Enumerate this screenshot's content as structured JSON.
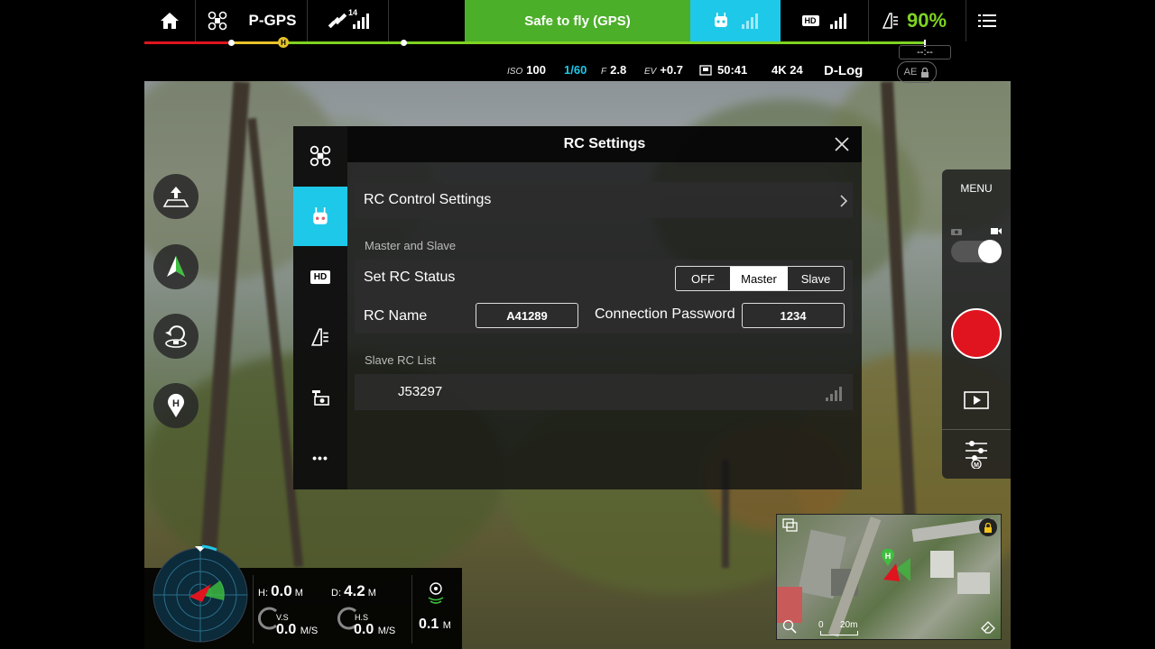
{
  "topbar": {
    "flight_mode": "P-GPS",
    "satellite_count": "14",
    "status_text": "Safe to fly (GPS)",
    "status_color": "#4caf2a",
    "rc_signal_color": "#1ec8e8",
    "hd_label": "HD",
    "battery_percent": "90%",
    "battery_color": "#7ed321",
    "flight_time": "--:--"
  },
  "camera": {
    "iso_label": "ISO",
    "iso_value": "100",
    "shutter": "1/60",
    "aperture_label": "F",
    "aperture_value": "2.8",
    "ev_label": "EV",
    "ev_value": "+0.7",
    "remaining_time": "50:41",
    "resolution": "4K 24",
    "color_profile": "D-Log",
    "ae_label": "AE"
  },
  "dialog": {
    "title": "RC Settings",
    "rc_control_settings": "RC Control Settings",
    "section_master_slave": "Master and Slave",
    "set_rc_status_label": "Set RC Status",
    "status_options": [
      "OFF",
      "Master",
      "Slave"
    ],
    "status_selected": "Master",
    "rc_name_label": "RC Name",
    "rc_name_value": "A41289",
    "connection_password_label": "Connection Password",
    "connection_password_value": "1234",
    "section_slave_list": "Slave RC List",
    "slave_rc": "J53297",
    "sidebar_hd": "HD",
    "sidebar_more": "•••",
    "active_tab_color": "#1ec8e8"
  },
  "campanel": {
    "menu_label": "MENU",
    "record_color": "#e0141e",
    "mode_label": "M"
  },
  "telemetry": {
    "h_label": "H:",
    "h_value": "0.0",
    "h_unit": "M",
    "d_label": "D:",
    "d_value": "4.2",
    "d_unit": "M",
    "vs_label": "V.S",
    "vs_value": "0.0",
    "vs_unit": "M/S",
    "hs_label": "H.S",
    "hs_value": "0.0",
    "hs_unit": "M/S",
    "vps_value": "0.1",
    "vps_unit": "M"
  },
  "map": {
    "scale_zero": "0",
    "scale_label": "20m"
  }
}
